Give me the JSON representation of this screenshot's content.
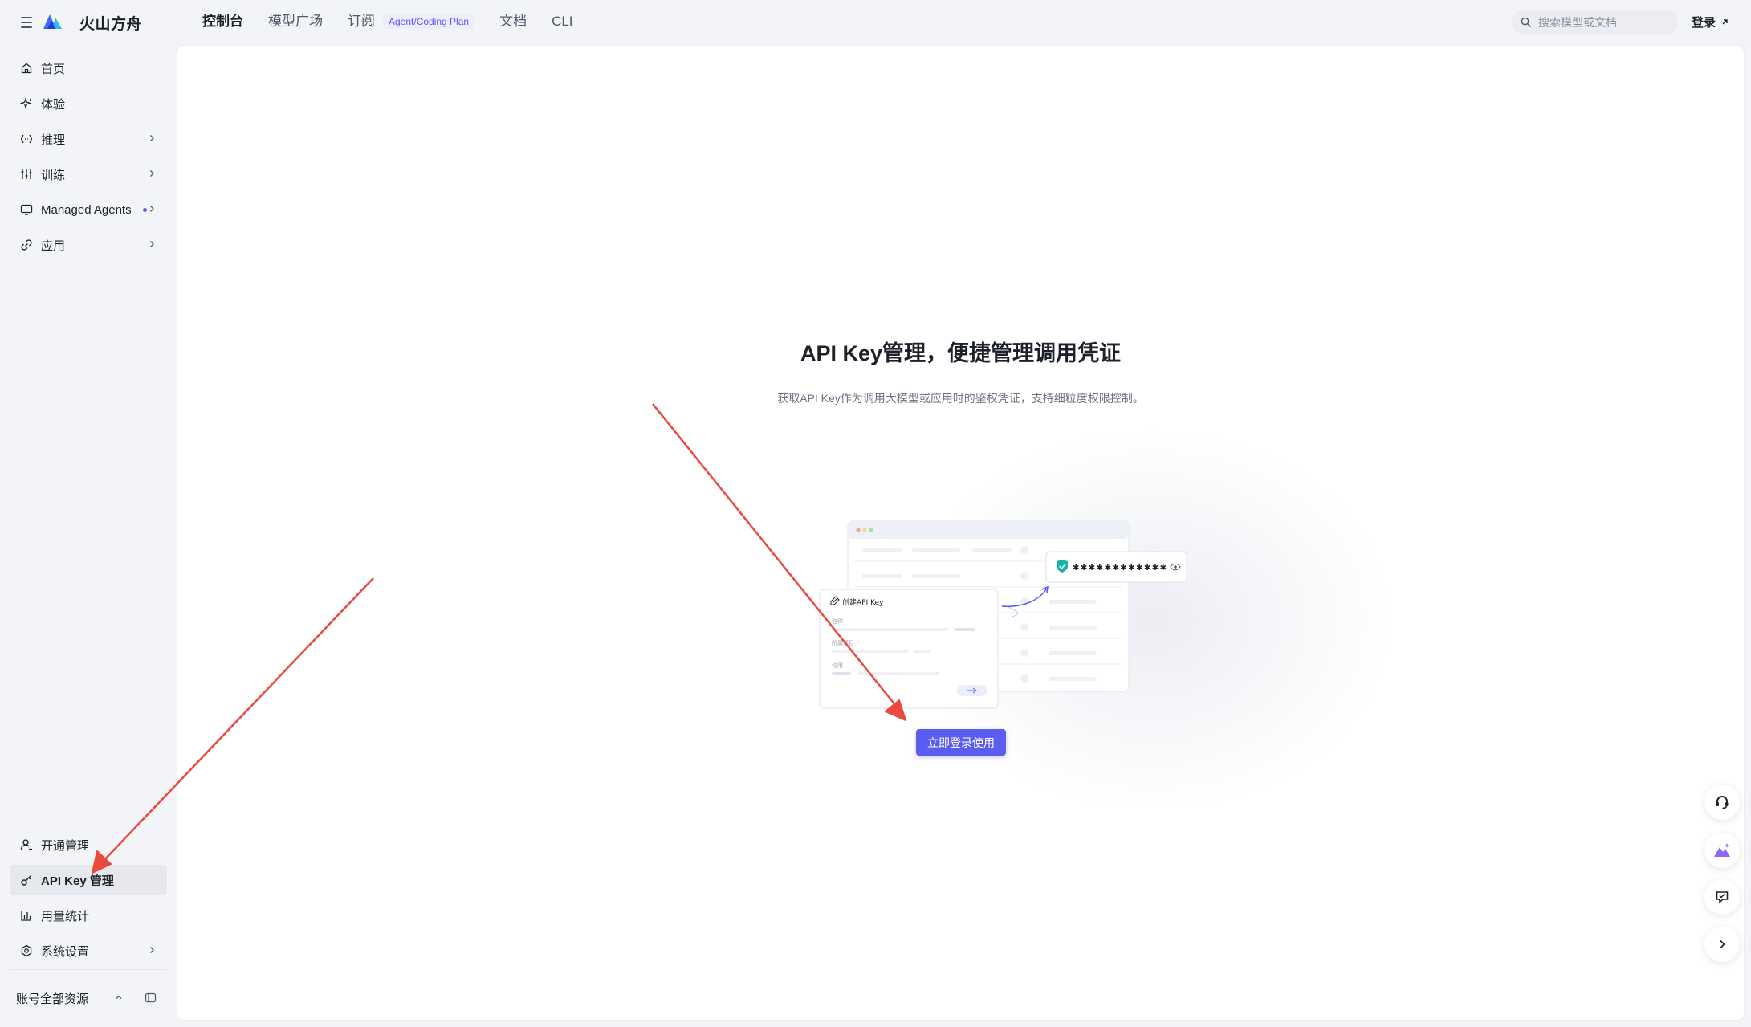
{
  "app": {
    "brand": "火山方舟"
  },
  "nav": {
    "items": [
      {
        "label": "控制台",
        "active": true
      },
      {
        "label": "模型广场"
      },
      {
        "label": "订阅",
        "badge": "Agent/Coding Plan"
      },
      {
        "label": "文档"
      },
      {
        "label": "CLI"
      }
    ]
  },
  "search": {
    "placeholder": "搜索模型或文档"
  },
  "header": {
    "login_label": "登录"
  },
  "sidebar": {
    "items": [
      {
        "label": "首页",
        "icon": "home-icon"
      },
      {
        "label": "体验",
        "icon": "sparkle-icon"
      },
      {
        "label": "推理",
        "icon": "code-icon",
        "expandable": true
      },
      {
        "label": "训练",
        "icon": "sliders-icon",
        "expandable": true
      },
      {
        "label": "Managed Agents",
        "icon": "monitor-icon",
        "expandable": true,
        "dot": true
      },
      {
        "label": "应用",
        "icon": "link-icon",
        "expandable": true
      }
    ],
    "bottom_items": [
      {
        "label": "开通管理",
        "icon": "user-icon"
      },
      {
        "label": "API Key 管理",
        "icon": "key-icon",
        "active": true
      },
      {
        "label": "用量统计",
        "icon": "bar-chart-icon"
      },
      {
        "label": "系统设置",
        "icon": "settings-icon",
        "expandable": true
      }
    ],
    "footer_label": "账号全部资源"
  },
  "main": {
    "title": "API Key管理，便捷管理调用凭证",
    "subtitle": "获取API Key作为调用大模型或应用时的鉴权凭证，支持细粒度权限控制。",
    "cta_label": "立即登录使用",
    "illustration": {
      "create_label": "创建API Key",
      "field_name": "名称",
      "field_project": "所属项目",
      "field_permission": "权限",
      "masked_key": "✱✱✱✱✱✱✱✱✱✱✱✱"
    }
  },
  "colors": {
    "accent": "#5b5cf0",
    "annotation": "#e84a3f"
  }
}
